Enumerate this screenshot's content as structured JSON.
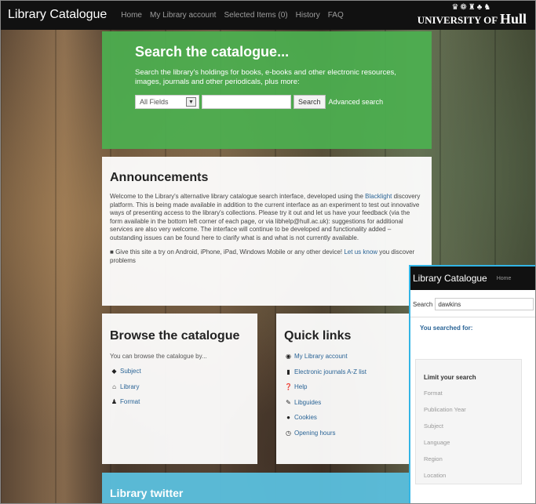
{
  "navbar": {
    "brand": "Library Catalogue",
    "links": [
      "Home",
      "My Library account",
      "Selected Items (0)",
      "History",
      "FAQ"
    ],
    "university": {
      "crest_icon": "university-crest-icon",
      "line1": "UNIVERSITY OF",
      "line2": "Hull"
    }
  },
  "hero": {
    "title": "Search the catalogue...",
    "description": "Search the library's holdings for books, e-books and other electronic resources, images, journals and other periodicals, plus more:",
    "field_select": "All Fields",
    "query_value": "",
    "search_button": "Search",
    "advanced_link": "Advanced search"
  },
  "announcements": {
    "title": "Announcements",
    "p1_before": "Welcome to the Library's alternative library catalogue search interface, developed using the ",
    "p1_link": "Blacklight",
    "p1_after": " discovery platform. This is being made available in addition to the current interface as an experiment to test out innovative ways of presenting access to the library's collections. Please try it out and let us have your feedback (via the form available in the bottom left corner of each page, or via libhelp@hull.ac.uk): suggestions for additional services are also very welcome. The interface will continue to be developed and functionality added – outstanding issues can be found here to clarify what is and what is not currently available.",
    "p2": "Give this site a try on Android, iPhone, iPad, Windows Mobile or any other device!",
    "p2_link": "Let us know",
    "p2_after": " you discover problems"
  },
  "browse": {
    "title": "Browse the catalogue",
    "intro": "You can browse the catalogue by...",
    "items": [
      {
        "label": "Subject",
        "icon": "tags-icon"
      },
      {
        "label": "Library",
        "icon": "home-icon"
      },
      {
        "label": "Format",
        "icon": "user-icon"
      }
    ]
  },
  "quick_links": {
    "title": "Quick links",
    "items": [
      {
        "label": "My Library account",
        "icon": "eye-icon"
      },
      {
        "label": "Electronic journals A-Z list",
        "icon": "book-icon"
      },
      {
        "label": "Help",
        "icon": "question-icon"
      },
      {
        "label": "Libguides",
        "icon": "pencil-icon"
      },
      {
        "label": "Cookies",
        "icon": "info-icon"
      },
      {
        "label": "Opening hours",
        "icon": "clock-icon"
      }
    ]
  },
  "twitter": {
    "title": "Library twitter"
  },
  "inset": {
    "brand": "Library Catalogue",
    "home": "Home",
    "search_label": "Search",
    "search_value": "dawkins",
    "searched_for": "You searched for:",
    "limit_title": "Limit your search",
    "facets": [
      "Format",
      "Publication Year",
      "Subject",
      "Language",
      "Region",
      "Location"
    ]
  },
  "colors": {
    "hero_green": "#4caf50",
    "twitter_blue": "#5bc0de",
    "navbar": "#111111",
    "link": "#2a6496"
  }
}
